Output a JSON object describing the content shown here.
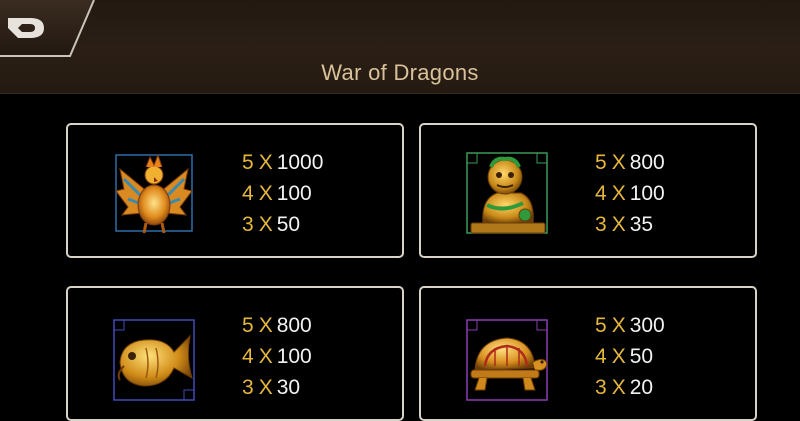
{
  "header": {
    "title": "War of Dragons"
  },
  "icons": {
    "back": "back-arrow-icon"
  },
  "colors": {
    "gold": "#e6b73d",
    "title": "#d9c19a",
    "card_border": "#d8d2c8",
    "header_bg": "#2b1f15"
  },
  "paytable": [
    {
      "symbol": "phoenix-icon",
      "pays": [
        {
          "count": "5",
          "x": "X",
          "value": "1000"
        },
        {
          "count": "4",
          "x": "X",
          "value": "100"
        },
        {
          "count": "3",
          "x": "X",
          "value": "50"
        }
      ]
    },
    {
      "symbol": "foo-dog-icon",
      "pays": [
        {
          "count": "5",
          "x": "X",
          "value": "800"
        },
        {
          "count": "4",
          "x": "X",
          "value": "100"
        },
        {
          "count": "3",
          "x": "X",
          "value": "35"
        }
      ]
    },
    {
      "symbol": "koi-fish-icon",
      "pays": [
        {
          "count": "5",
          "x": "X",
          "value": "800"
        },
        {
          "count": "4",
          "x": "X",
          "value": "100"
        },
        {
          "count": "3",
          "x": "X",
          "value": "30"
        }
      ]
    },
    {
      "symbol": "turtle-icon",
      "pays": [
        {
          "count": "5",
          "x": "X",
          "value": "300"
        },
        {
          "count": "4",
          "x": "X",
          "value": "50"
        },
        {
          "count": "3",
          "x": "X",
          "value": "20"
        }
      ]
    }
  ]
}
